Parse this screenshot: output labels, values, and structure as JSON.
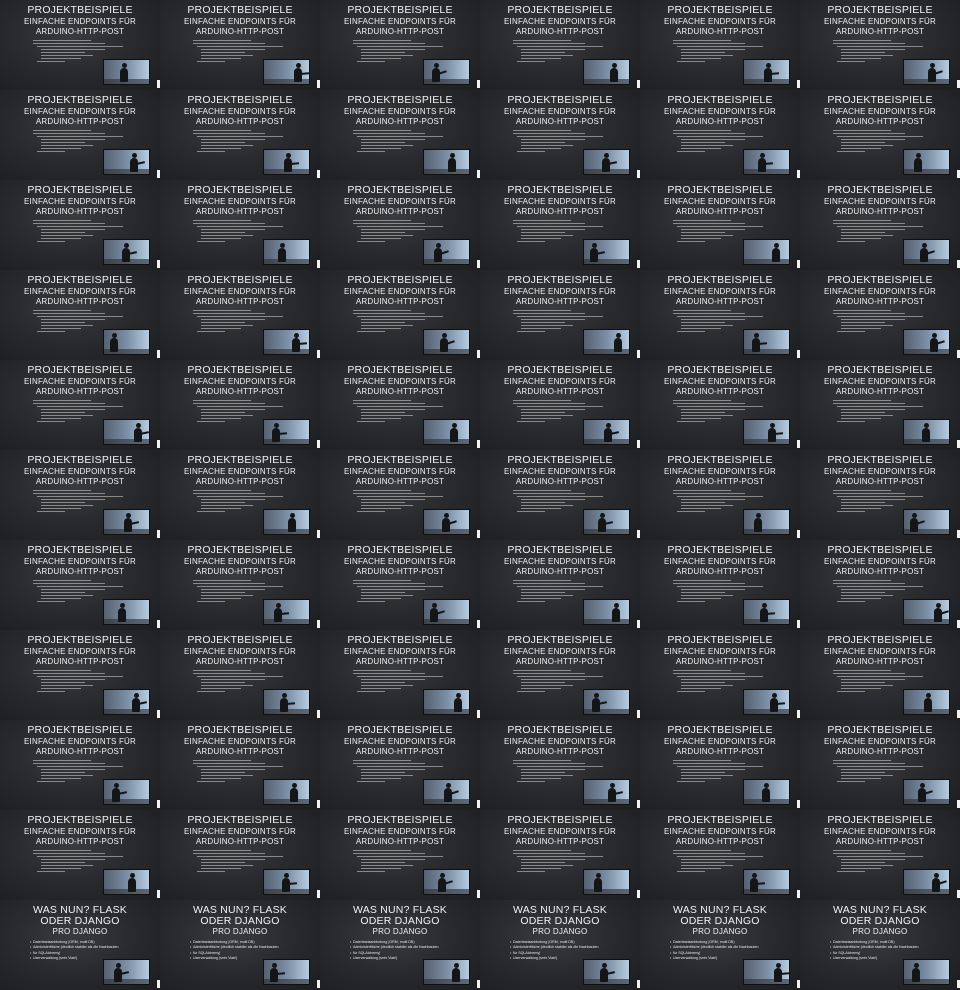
{
  "slides": {
    "project": {
      "title": "PROJEKTBEISPIELE",
      "subtitle_lines": [
        "EINFACHE ENDPOINTS FÜR",
        "ARDUINO-HTTP-POST"
      ]
    },
    "flask": {
      "title_lines": [
        "WAS NUN? FLASK",
        "ODER DJANGO"
      ],
      "subtitle": "PRO DJANGO",
      "bullets": [
        "Datenbankanbindung (ORM, multi DB)",
        "Administerfläche (deutlich stabiler als die Nachbauten",
        "für SQLAlchemy)",
        "Userverwaltung (sehr Viabl)"
      ]
    }
  },
  "grid": {
    "columns": 6,
    "rows": 11,
    "flask_row": 11
  },
  "colors": {
    "slide_background": "#2a2b2e",
    "page_background": "#1b1c1e",
    "text": "#f2f2f2",
    "inset_sky": "#8ea3bb",
    "presenter": "#141517"
  }
}
